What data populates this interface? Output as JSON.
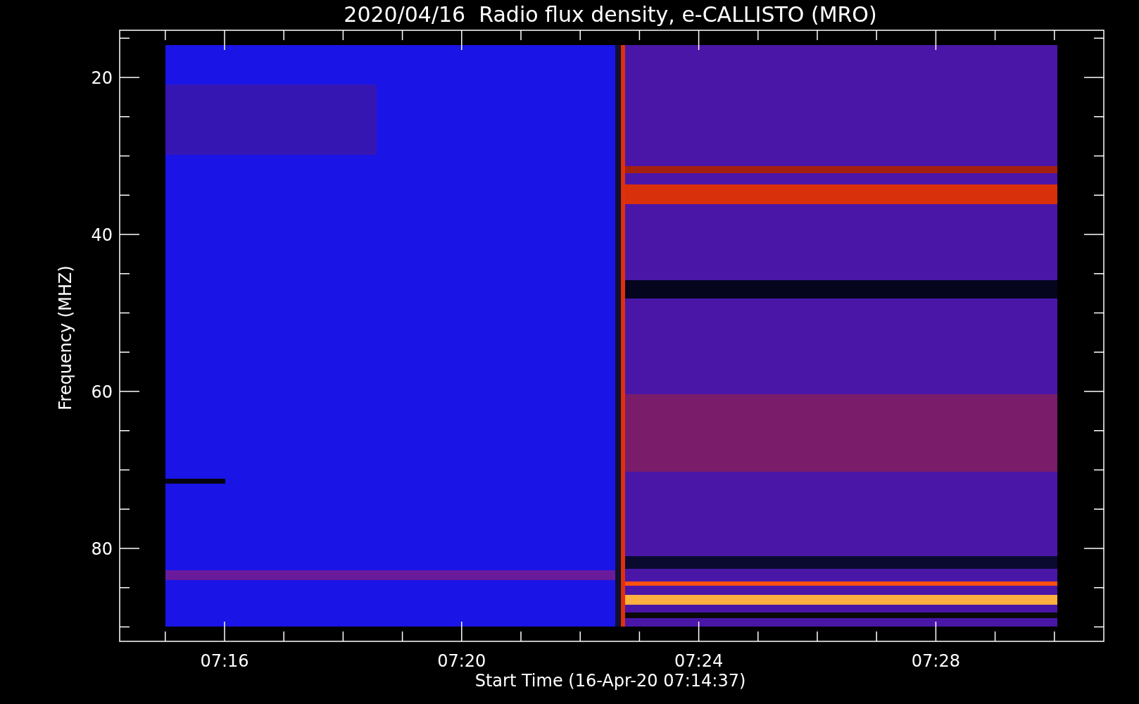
{
  "title": "2020/04/16  Radio flux density, e-CALLISTO (MRO)",
  "y_axis": {
    "label": "Frequency (MHZ)",
    "ticks": [
      "20",
      "40",
      "60",
      "80"
    ]
  },
  "x_axis": {
    "label": "Start Time (16-Apr-20 07:14:37)",
    "ticks": [
      "07:16",
      "07:20",
      "07:24",
      "07:28"
    ]
  }
}
